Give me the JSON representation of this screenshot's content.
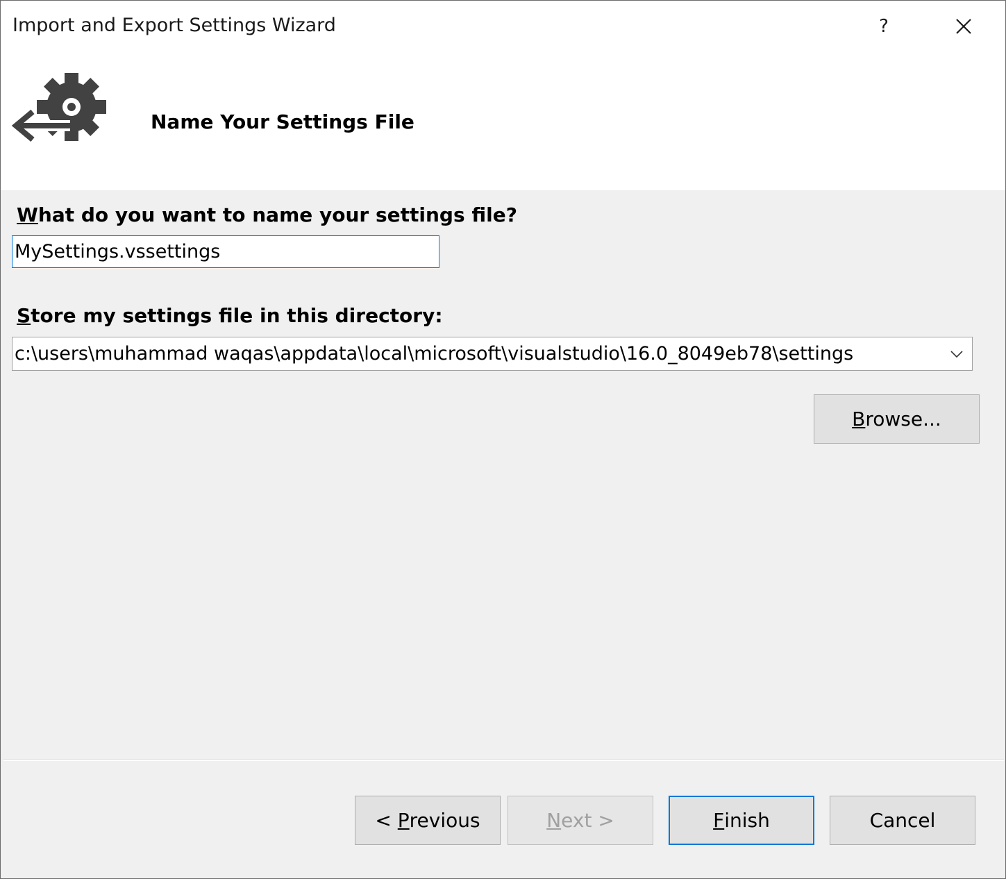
{
  "window": {
    "title": "Import and Export Settings Wizard",
    "help_label": "?",
    "close_label": "✕"
  },
  "header": {
    "title": "Name Your Settings File",
    "icon": "gear-export-icon"
  },
  "form": {
    "name_label_accel": "W",
    "name_label_rest": "hat do you want to name your settings file?",
    "name_value": "MySettings.vssettings",
    "dir_label_accel": "S",
    "dir_label_rest": "tore my settings file in this directory:",
    "dir_value": "c:\\users\\muhammad waqas\\appdata\\local\\microsoft\\visualstudio\\16.0_8049eb78\\settings",
    "browse_accel": "B",
    "browse_rest": "rowse..."
  },
  "footer": {
    "previous_prefix": "< ",
    "previous_accel": "P",
    "previous_rest": "revious",
    "next_accel": "N",
    "next_rest": "ext >",
    "finish_accel": "F",
    "finish_rest": "inish",
    "cancel_label": "Cancel"
  },
  "colors": {
    "accent": "#0078d7",
    "dialog_bg": "#f0f0f0",
    "header_bg": "#ffffff",
    "disabled_text": "#a0a0a0"
  }
}
